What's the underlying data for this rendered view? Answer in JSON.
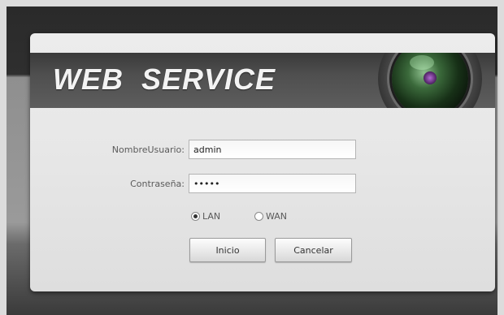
{
  "banner": {
    "title": "WEB  SERVICE",
    "lens_icon": "camera-lens-icon"
  },
  "login": {
    "username_label": "NombreUsuario:",
    "username_value": "admin",
    "password_label": "Contraseña:",
    "password_value": "*****",
    "network_options": [
      {
        "label": "LAN",
        "checked": true
      },
      {
        "label": "WAN",
        "checked": false
      }
    ],
    "login_button": "Inicio",
    "cancel_button": "Cancelar"
  },
  "colors": {
    "banner_dark": "#3a3a3a",
    "dialog_bg": "#e7e7e7",
    "lens_green": "#3b6a3b"
  }
}
